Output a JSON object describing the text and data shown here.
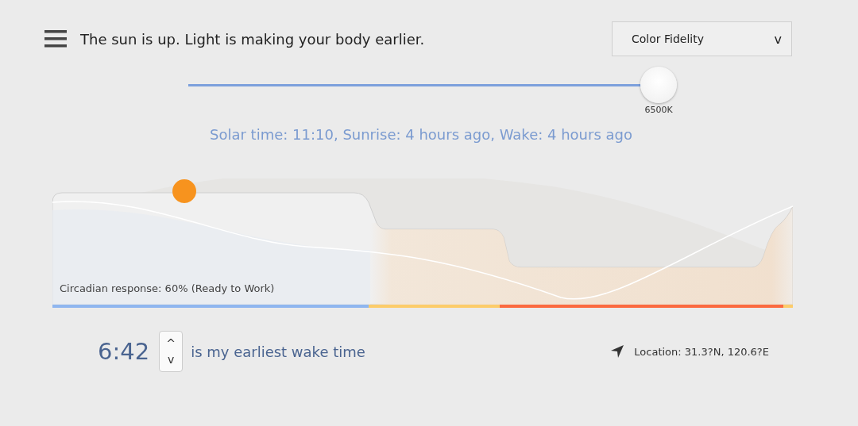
{
  "header": {
    "message": "The sun is up. Light is making your body earlier.",
    "dropdown": {
      "value": "Color Fidelity",
      "caret": "v"
    }
  },
  "slider": {
    "level": 1,
    "reading": "6500K"
  },
  "solar_info": "Solar time: 11:10, Sunrise: 4 hours ago, Wake: 4 hours ago",
  "chart": {
    "caption": "Circadian response: 60% (Ready to Work)"
  },
  "wake": {
    "time": "6:42",
    "up": "^",
    "down": "v",
    "label": "is my earliest wake time"
  },
  "location": "Location: 31.3?N, 120.6?E"
}
